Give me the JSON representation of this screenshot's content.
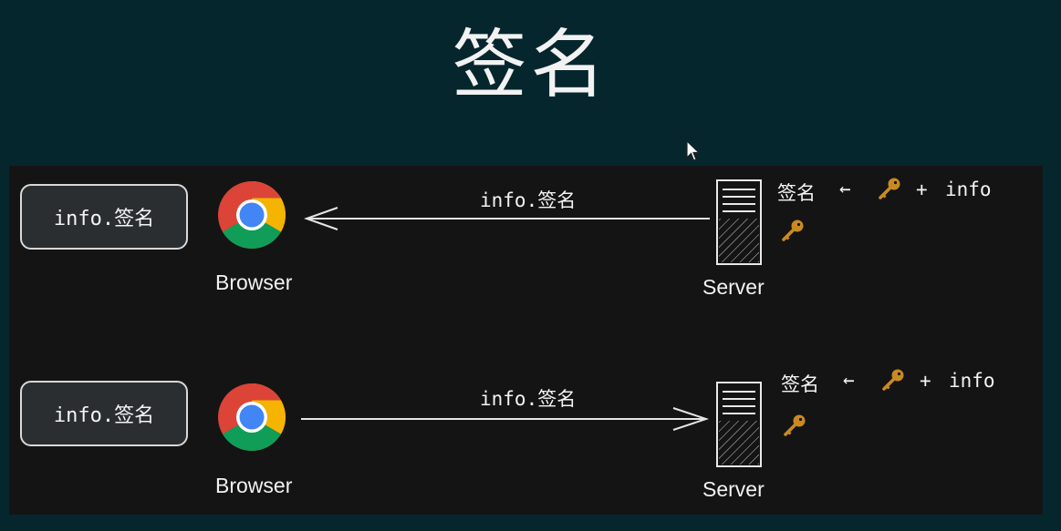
{
  "title": "签名",
  "rows": [
    {
      "box_label": "info.签名",
      "browser_label": "Browser",
      "message": "info.签名",
      "direction": "server-to-browser",
      "server_label": "Server",
      "formula": {
        "result": "签名",
        "arrow": "←",
        "plus": "+",
        "operand": "info"
      }
    },
    {
      "box_label": "info.签名",
      "browser_label": "Browser",
      "message": "info.签名",
      "direction": "browser-to-server",
      "server_label": "Server",
      "formula": {
        "result": "签名",
        "arrow": "←",
        "plus": "+",
        "operand": "info"
      }
    }
  ],
  "colors": {
    "background": "#06262d",
    "panel": "#141414",
    "key": "#c98a22",
    "chrome_red": "#db4437",
    "chrome_green": "#0f9d58",
    "chrome_yellow": "#f4b400",
    "chrome_blue": "#4285f4"
  }
}
